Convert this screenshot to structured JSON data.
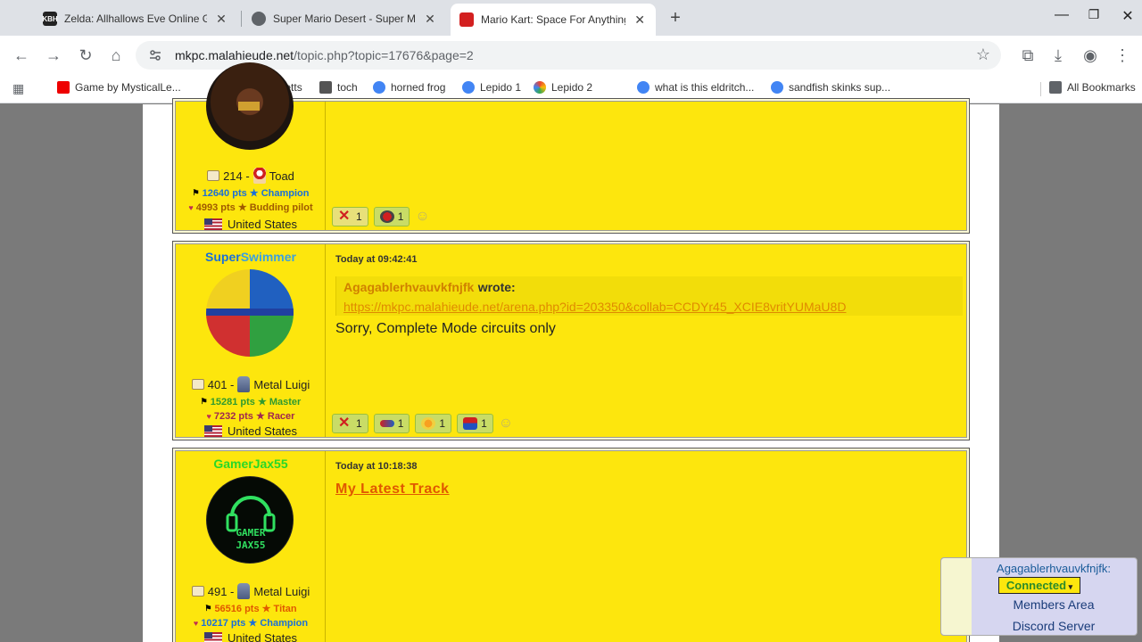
{
  "browser": {
    "tabs": [
      {
        "title": "Zelda: Allhallows Eve Online Ga",
        "favicon": "KBH"
      },
      {
        "title": "Super Mario Desert - Super Mar",
        "favicon": ""
      },
      {
        "title": "Mario Kart: Space For Anything",
        "favicon": ""
      }
    ],
    "url_host": "mkpc.malahieude.net",
    "url_path": "/topic.php?topic=17676&page=2",
    "bookmarks": [
      "Game by MysticalLe...",
      "peta budgetts",
      "toch",
      "horned frog",
      "Lepido 1",
      "Lepido 2",
      "what is this eldritch...",
      "sandfish skinks sup...",
      "All Bookmarks"
    ]
  },
  "posts": [
    {
      "messages": "214 -",
      "character": "Toad",
      "pts1": "12640 pts ★ Champion",
      "pts1_color": "#1a6fd8",
      "pts2": "4993 pts ★ Budding pilot",
      "pts2_color": "#a05a00",
      "country": "United States",
      "reactions": [
        "1",
        "1"
      ]
    },
    {
      "username_a": "Super",
      "username_b": "Swimmer",
      "timestamp": "Today at 09:42:41",
      "quote_author": "Agagablerhvauvkfnjfk",
      "quote_wrote": "wrote:",
      "quote_link": "https://mkpc.malahieude.net/arena.php?id=203350&collab=CCDYr45_XCIE8vritYUMaU8D",
      "text": "Sorry, Complete Mode circuits only",
      "messages": "401 -",
      "character": "Metal Luigi",
      "pts1": "15281 pts ★ Master",
      "pts1_color": "#2f9a2f",
      "pts2": "7232 pts ★ Racer",
      "pts2_color": "#a02850",
      "country": "United States",
      "reactions": [
        "1",
        "1",
        "1",
        "1"
      ]
    },
    {
      "username": "GamerJax55",
      "timestamp": "Today at 10:18:38",
      "title_link": "My Latest Track",
      "messages": "491 -",
      "character": "Metal Luigi",
      "pts1": "56516 pts ★ Titan",
      "pts1_color": "#e05800",
      "pts2": "10217 pts ★ Champion",
      "pts2_color": "#1a6fd8",
      "country": "United States",
      "avatar_text_1": "GAMER",
      "avatar_text_2": "JAX55"
    }
  ],
  "chat": {
    "user": "Agagablerhvauvkfnjfk:",
    "status": "Connected",
    "links": [
      "Members Area",
      "Discord Server"
    ]
  }
}
